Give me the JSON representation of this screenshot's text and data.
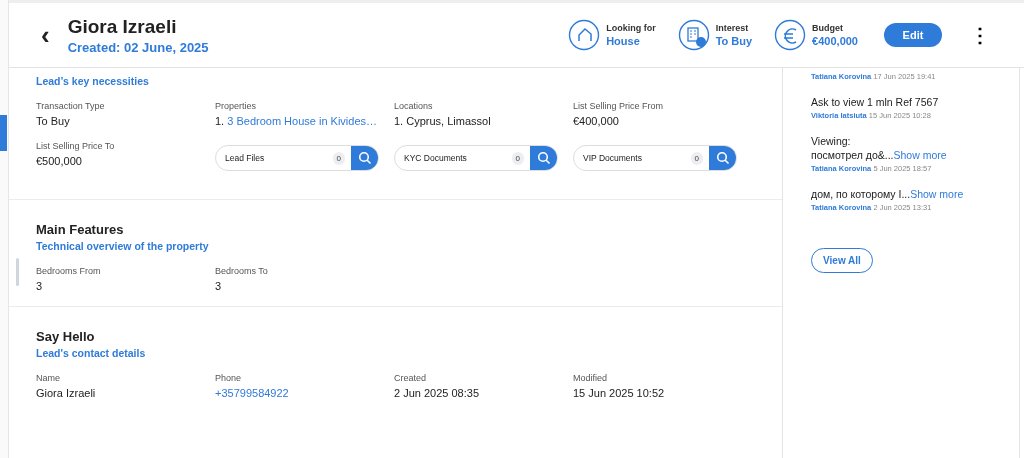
{
  "header": {
    "back": "‹",
    "name": "Giora Izraeli",
    "created": "Created: 02 June, 2025",
    "stats": [
      {
        "kind": "house",
        "label": "Looking for",
        "value": "House"
      },
      {
        "kind": "building",
        "label": "Interest",
        "value": "To Buy"
      },
      {
        "kind": "euro",
        "label": "Budget",
        "value": "€400,000"
      }
    ],
    "edit": "Edit",
    "more": "⋮"
  },
  "sections": [
    {
      "subtitle": "Lead’s key necessities",
      "items": [
        {
          "kind": "field",
          "label": "Transaction Type",
          "value": "To Buy"
        },
        {
          "kind": "link",
          "label": "Properties",
          "index": "1.",
          "value": "3 Bedroom House in Kivides…"
        },
        {
          "kind": "field",
          "label": "Locations",
          "value": "1. Cyprus, Limassol"
        },
        {
          "kind": "field",
          "label": "List Selling Price From",
          "value": "€400,000"
        },
        {
          "kind": "field",
          "label": "List Selling Price To",
          "value": "€500,000"
        },
        {
          "kind": "docs",
          "label": "Lead Files",
          "count": "0"
        },
        {
          "kind": "docs",
          "label": "KYC Documents",
          "count": "0"
        },
        {
          "kind": "docs",
          "label": "VIP Documents",
          "count": "0"
        }
      ]
    },
    {
      "title": "Main Features",
      "subtitle": "Technical overview of the property",
      "items": [
        {
          "kind": "field",
          "label": "Bedrooms From",
          "value": "3"
        },
        {
          "kind": "field",
          "label": "Bedrooms To",
          "value": "3"
        }
      ]
    },
    {
      "title": "Say Hello",
      "subtitle": "Lead's contact details",
      "items": [
        {
          "kind": "field",
          "label": "Name",
          "value": "Giora Izraeli"
        },
        {
          "kind": "link",
          "label": "Phone",
          "value": "+35799584922"
        },
        {
          "kind": "field",
          "label": "Created",
          "value": "2 Jun 2025 08:35"
        },
        {
          "kind": "field",
          "label": "Modified",
          "value": "15 Jun 2025 10:52"
        }
      ]
    }
  ],
  "notes": [
    {
      "author": "Tatiana Korovina",
      "date": "17 Jun 2025 19:41"
    },
    {
      "lines": [
        "Ask to view 1 mln Ref 7567"
      ],
      "author": "Viktoria Iatsiuta",
      "date": "15 Jun 2025 10:28"
    },
    {
      "lines": [
        "Viewing:",
        "посмотрел до&..."
      ],
      "more": "Show more",
      "author": "Tatiana Korovina",
      "date": "5 Jun 2025 18:57"
    },
    {
      "lines": [
        "дом, по которому I..."
      ],
      "more": "Show more",
      "author": "Tatiana Korovina",
      "date": "2 Jun 2025 13:31"
    }
  ],
  "view_all": "View All"
}
